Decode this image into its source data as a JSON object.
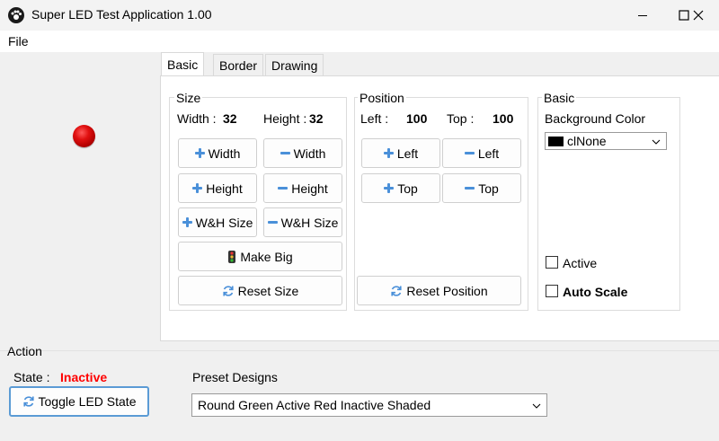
{
  "window": {
    "title": "Super LED Test Application 1.00"
  },
  "menu": {
    "file": "File"
  },
  "tabs": [
    "Basic",
    "Border",
    "Drawing"
  ],
  "size_group": {
    "label": "Size",
    "width_label": "Width :",
    "width_value": "32",
    "height_label": "Height :",
    "height_value": "32",
    "buttons": {
      "inc_width": "Width",
      "dec_width": "Width",
      "inc_height": "Height",
      "dec_height": "Height",
      "inc_wh": "W&H Size",
      "dec_wh": "W&H Size",
      "make_big": "Make Big",
      "reset_size": "Reset Size"
    }
  },
  "position_group": {
    "label": "Position",
    "left_label": "Left :",
    "left_value": "100",
    "top_label": "Top :",
    "top_value": "100",
    "buttons": {
      "inc_left": "Left",
      "dec_left": "Left",
      "inc_top": "Top",
      "dec_top": "Top",
      "reset_position": "Reset Position"
    }
  },
  "basic_group": {
    "label": "Basic",
    "bg_color_label": "Background Color",
    "bg_color_value": "clNone",
    "active_label": "Active",
    "active_checked": false,
    "auto_scale_label": "Auto Scale",
    "auto_scale_checked": false
  },
  "action": {
    "label": "Action",
    "state_label": "State :",
    "state_value": "Inactive",
    "toggle_button": "Toggle LED State",
    "preset_label": "Preset Designs",
    "preset_value": "Round Green Active Red Inactive Shaded"
  },
  "colors": {
    "led": "#e01010",
    "state_inactive": "#ff0000",
    "accent_border": "#5b9bd5",
    "icon_blue": "#4a90d9"
  }
}
